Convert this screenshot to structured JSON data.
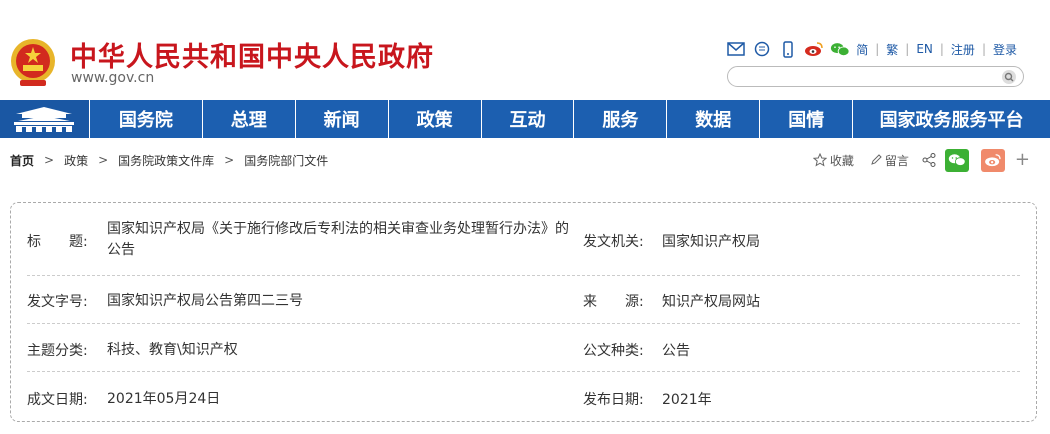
{
  "header": {
    "title": "中华人民共和国中央人民政府",
    "url": "www.gov.cn",
    "links": {
      "simplified": "简",
      "traditional": "繁",
      "english": "EN",
      "register": "注册",
      "login": "登录"
    },
    "search_placeholder": ""
  },
  "nav": {
    "items": [
      {
        "label": "国务院"
      },
      {
        "label": "总理"
      },
      {
        "label": "新闻"
      },
      {
        "label": "政策"
      },
      {
        "label": "互动"
      },
      {
        "label": "服务"
      },
      {
        "label": "数据"
      },
      {
        "label": "国情"
      },
      {
        "label": "国家政务服务平台"
      }
    ]
  },
  "breadcrumb": {
    "home": "首页",
    "items": [
      "政策",
      "国务院政策文件库",
      "国务院部门文件"
    ]
  },
  "actions": {
    "favorite": "收藏",
    "comment": "留言",
    "more": "+"
  },
  "info": {
    "title_label": "标　　题:",
    "title_value": "国家知识产权局《关于施行修改后专利法的相关审查业务处理暂行办法》的公告",
    "issuer_label": "发文机关:",
    "issuer_value": "国家知识产权局",
    "docno_label": "发文字号:",
    "docno_value": "国家知识产权局公告第四二三号",
    "source_label": "来　　源:",
    "source_value": "知识产权局网站",
    "topic_label": "主题分类:",
    "topic_value": "科技、教育\\知识产权",
    "type_label": "公文种类:",
    "type_value": "公告",
    "date_label": "成文日期:",
    "date_value": "2021年05月24日",
    "pubdate_label": "发布日期:",
    "pubdate_value": "2021年"
  },
  "colors": {
    "brand_red": "#c8161d",
    "nav_blue": "#1c5fb0",
    "wechat_green": "#3cb034",
    "weibo_orange": "#f08a6b"
  }
}
